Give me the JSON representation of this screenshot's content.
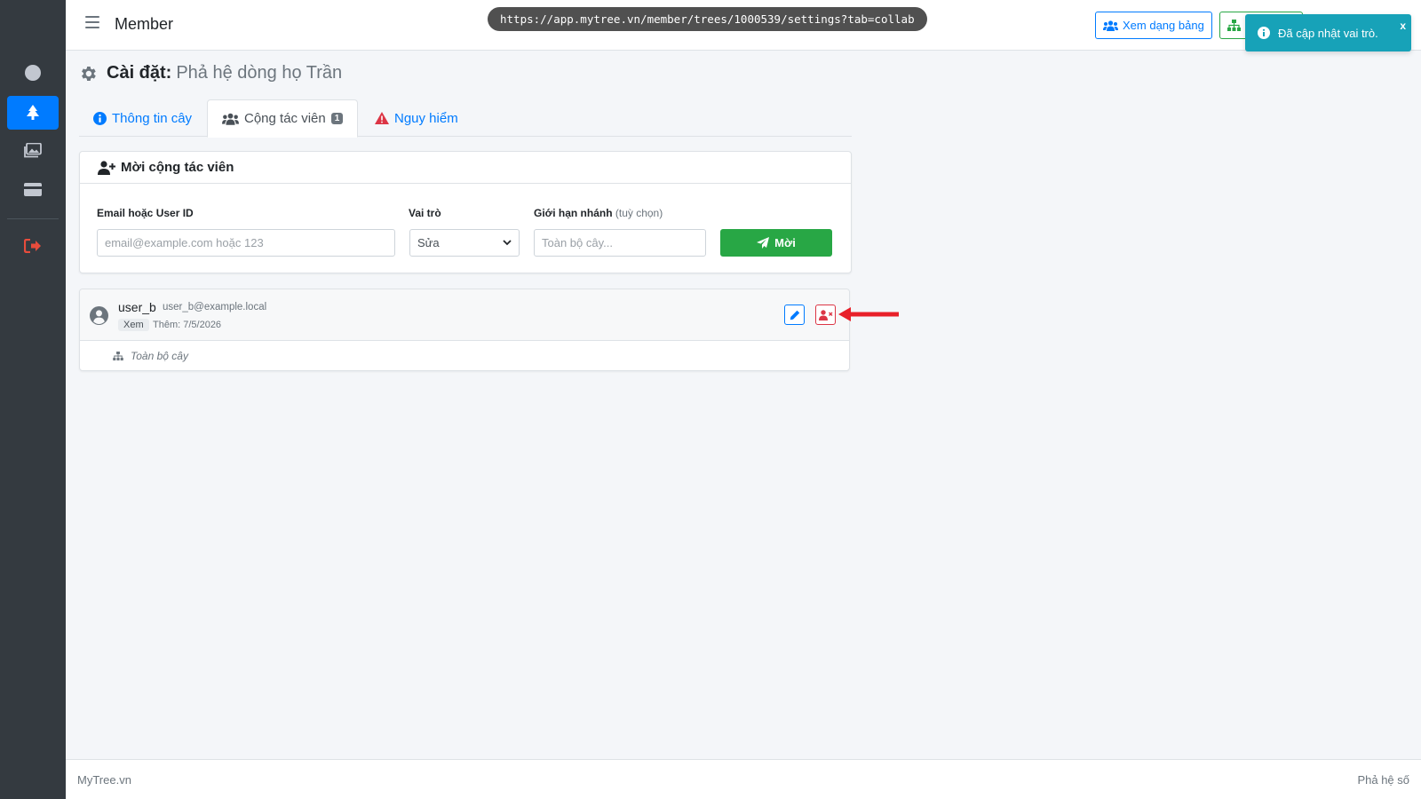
{
  "header": {
    "title": "Member",
    "url": "https://app.mytree.vn/member/trees/1000539/settings?tab=collab",
    "table_view_button": "Xem dạng bảng"
  },
  "toast": {
    "message": "Đã cập nhật vai trò.",
    "close": "x"
  },
  "page": {
    "title_label": "Cài đặt:",
    "title_value": "Phả hệ dòng họ Trần"
  },
  "tabs": [
    {
      "label": "Thông tin cây",
      "icon": "info-icon"
    },
    {
      "label": "Cộng tác viên",
      "icon": "users-icon",
      "badge": "1",
      "active": true
    },
    {
      "label": "Nguy hiểm",
      "icon": "warning-icon"
    }
  ],
  "invite": {
    "header": "Mời cộng tác viên",
    "email_label": "Email hoặc User ID",
    "email_placeholder": "email@example.com hoặc 123",
    "role_label": "Vai trò",
    "role_value": "Sửa",
    "branch_label": "Giới hạn nhánh",
    "branch_optional": "(tuỳ chọn)",
    "branch_placeholder": "Toàn bộ cây...",
    "submit": "Mời"
  },
  "members": [
    {
      "name": "user_b",
      "email": "user_b@example.local",
      "role": "Xem",
      "added": "Thêm: 7/5/2026",
      "scope": "Toàn bộ cây"
    }
  ],
  "footer": {
    "left": "MyTree.vn",
    "right": "Phả hệ số"
  },
  "colors": {
    "primary": "#007bff",
    "success": "#28a745",
    "danger": "#dc3545",
    "info": "#17a2b8",
    "sidebar": "#343a40"
  }
}
